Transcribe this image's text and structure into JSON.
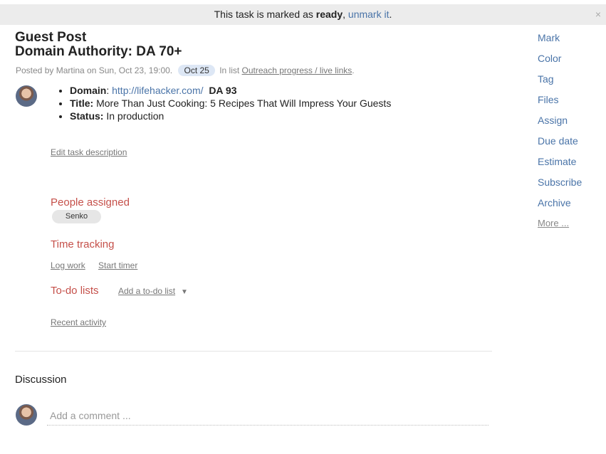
{
  "banner": {
    "prefix": "This task is marked as ",
    "bold": "ready",
    "sep": ", ",
    "link": "unmark it",
    "suffix": ".",
    "close": "×"
  },
  "task": {
    "title_line1": "Guest Post",
    "title_line2": "Domain Authority: DA 70+",
    "posted": "Posted by Martina on Sun, Oct 23, 19:00.",
    "date_badge": "Oct 25",
    "in_list": "In list",
    "list_name": "Outreach progress / live links",
    "list_suffix": "."
  },
  "description": {
    "domain_label": "Domain",
    "colon": ":",
    "domain_url": "http://lifehacker.com/",
    "da": "DA 93",
    "title_label": "Title:",
    "title_value": "More Than Just Cooking: 5 Recipes That Will Impress Your Guests",
    "status_label": "Status:",
    "status_value": "In production",
    "edit_link": "Edit task description"
  },
  "people": {
    "heading": "People assigned",
    "assignee": "Senko"
  },
  "time_tracking": {
    "heading": "Time tracking",
    "log_work": "Log work",
    "start_timer": "Start timer"
  },
  "todo": {
    "heading": "To-do lists",
    "add_link": "Add a to-do list",
    "arrow": "▼"
  },
  "recent_activity": "Recent activity",
  "discussion": {
    "heading": "Discussion",
    "placeholder": "Add a comment ..."
  },
  "sidebar": {
    "items": [
      "Mark",
      "Color",
      "Tag",
      "Files",
      "Assign",
      "Due date",
      "Estimate",
      "Subscribe",
      "Archive",
      "More ..."
    ]
  }
}
